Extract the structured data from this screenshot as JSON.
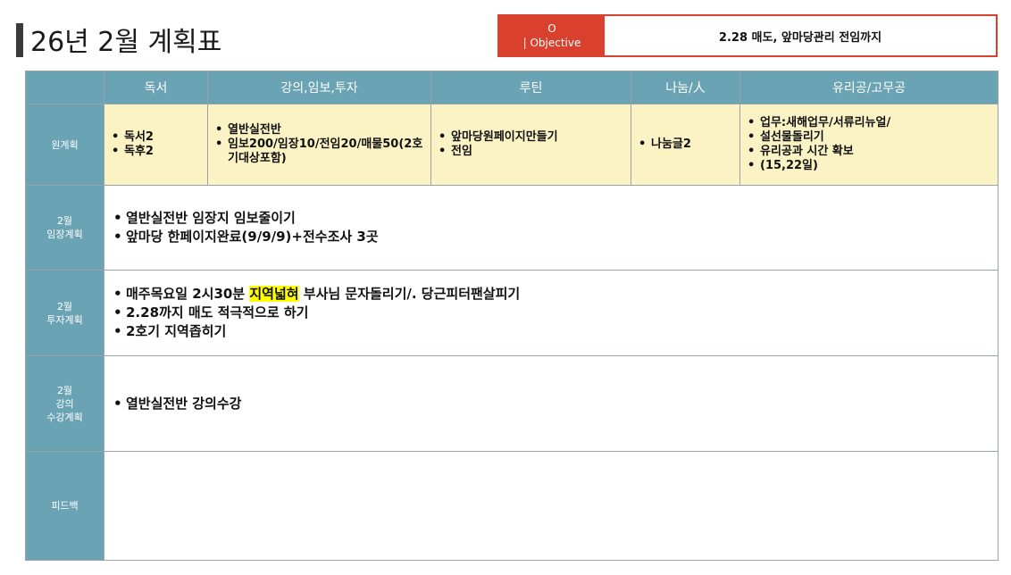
{
  "title": "26년 2월 계획표",
  "objective": {
    "label_line1": "O",
    "label_line2": "| Objective",
    "text": "2.28 매도, 앞마당관리 전임까지"
  },
  "columns": [
    "독서",
    "강의,임보,투자",
    "루틴",
    "나눔/人",
    "유리공/고무공"
  ],
  "rows": {
    "plan": {
      "label": "원계획",
      "reading": [
        "독서2",
        "독후2"
      ],
      "lecture": [
        "열반실전반",
        "임보200/임장10/전임20/매물50(2호기대상포함)"
      ],
      "routine": [
        "앞마당원페이지만들기",
        "전임"
      ],
      "sharing": [
        "나눔글2"
      ],
      "glass": [
        "업무:새해업무/서류리뉴얼/",
        "설선물돌리기",
        "유리공과 시간 확보",
        "(15,22일)"
      ]
    },
    "imjang": {
      "label_l1": "2월",
      "label_l2": "임장계획",
      "items": [
        "열반실전반 임장지 임보줄이기",
        "앞마당 한페이지완료(9/9/9)+전수조사 3곳"
      ]
    },
    "invest": {
      "label_l1": "2월",
      "label_l2": "투자계획",
      "item1_pre": "매주목요일 2시30분 ",
      "item1_highlight": "지역넓혀",
      "item1_post": " 부사님 문자돌리기/. 당근피터팬살피기",
      "item2": "2.28까지 매도 적극적으로 하기",
      "item3": "2호기 지역좁히기"
    },
    "lecture_plan": {
      "label_l1": "2월",
      "label_l2": "강의",
      "label_l3": "수강계획",
      "items": [
        "열반실전반 강의수강"
      ]
    },
    "feedback": {
      "label": "피드백"
    }
  },
  "colors": {
    "header_bg": "#6aa3b4",
    "plan_row_bg": "#fbf3c4",
    "objective_red": "#d9412e",
    "highlight": "#ffff00"
  }
}
